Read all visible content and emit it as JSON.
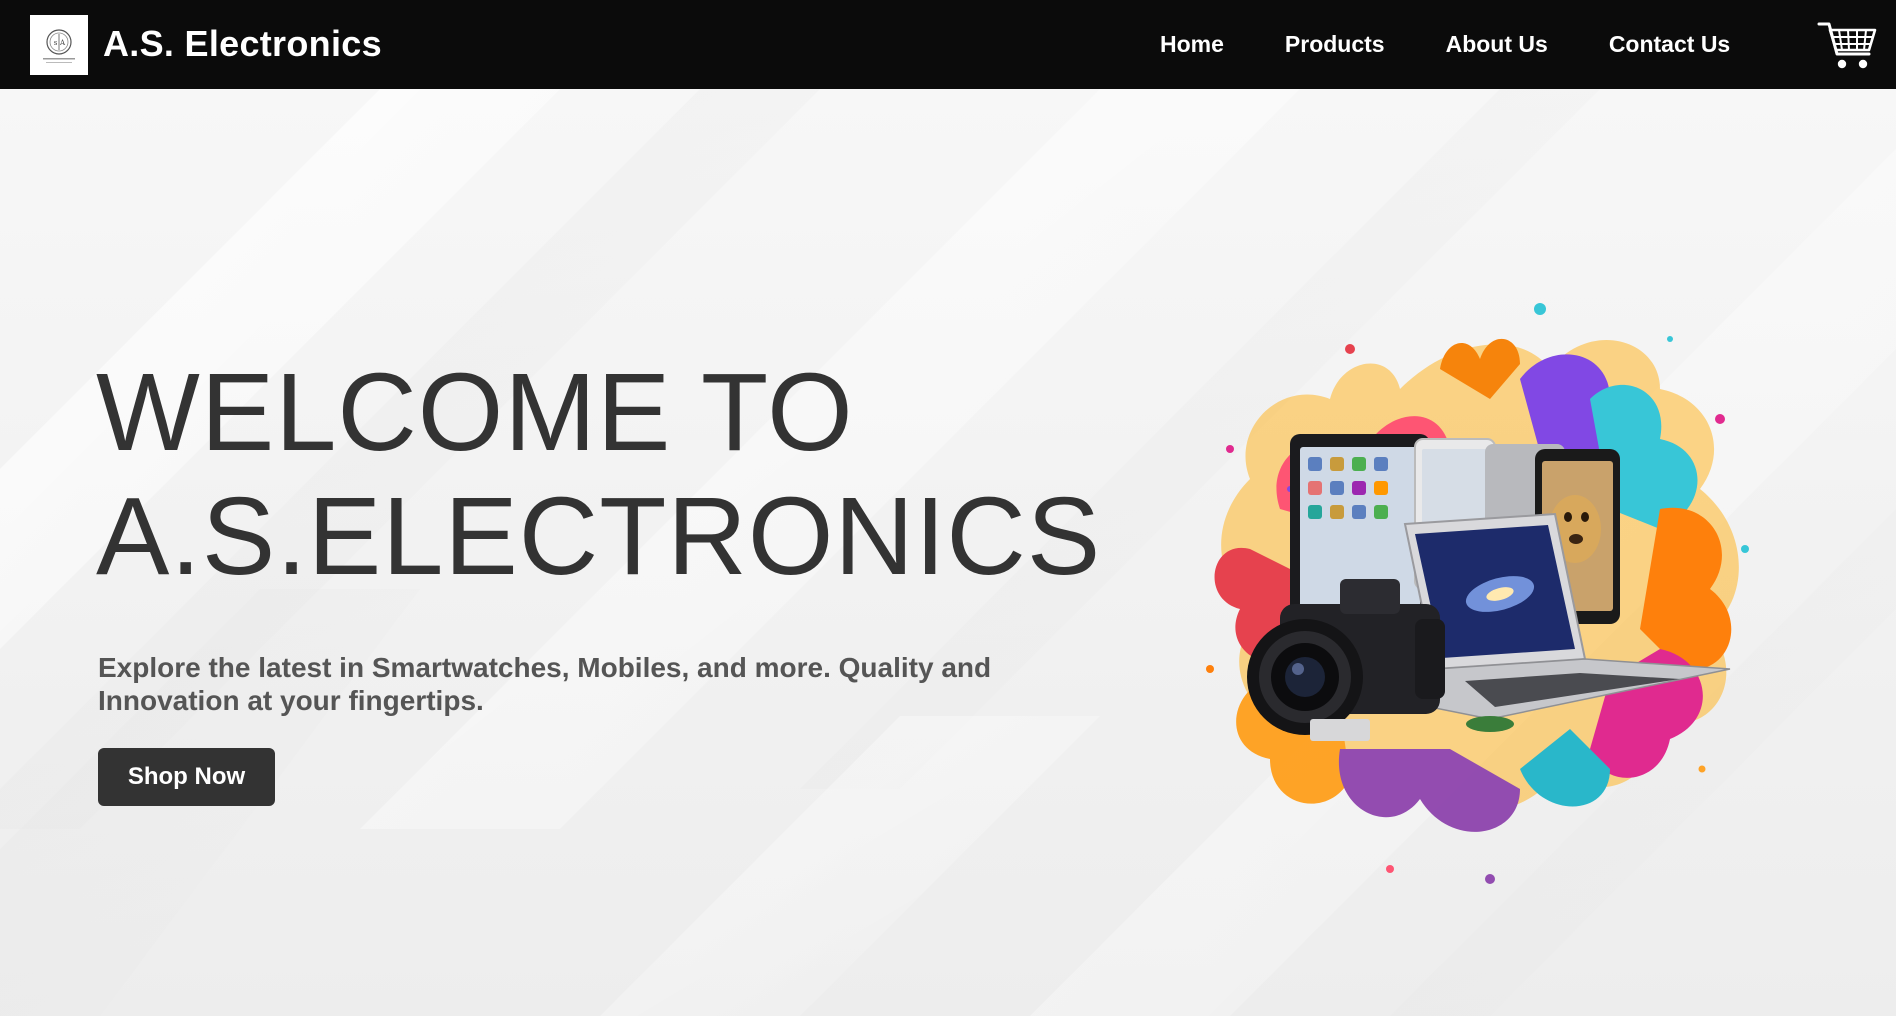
{
  "navbar": {
    "brand": "A.S. Electronics",
    "logo_icon": "as-monogram-logo",
    "links": [
      {
        "label": "Home"
      },
      {
        "label": "Products"
      },
      {
        "label": "About Us"
      },
      {
        "label": "Contact Us"
      }
    ],
    "cart_icon": "shopping-cart-icon",
    "background_color": "#0b0b0b",
    "text_color": "#ffffff"
  },
  "hero": {
    "title_line1": "WELCOME TO",
    "title_line2": "A.S.ELECTRONICS",
    "subtitle": "Explore the latest in Smartwatches, Mobiles, and more. Quality and Innovation at your fingertips.",
    "cta_label": "Shop Now",
    "title_color": "#333333",
    "subtitle_color": "#555555",
    "button_color": "#333333"
  }
}
